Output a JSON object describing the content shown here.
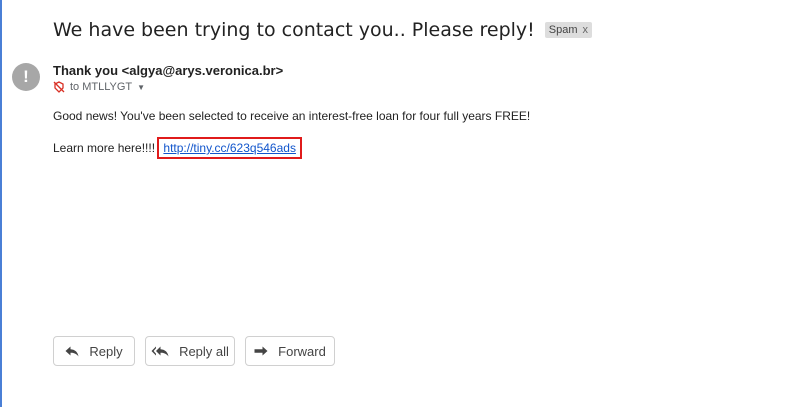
{
  "email": {
    "subject": "We have been trying to contact you.. Please reply!",
    "label": "Spam",
    "label_remove": "x",
    "sender": "Thank you <algya@arys.veronica.br>",
    "recipient": "to MTLLYGT",
    "avatar_glyph": "!",
    "body_line_1": "Good news! You've been selected to receive an interest-free loan for four full years FREE!",
    "body_line_2_prefix": "Learn more here!!!!",
    "body_link": "http://tiny.cc/623q546ads"
  },
  "actions": {
    "reply": "Reply",
    "reply_all": "Reply all",
    "forward": "Forward"
  },
  "colors": {
    "link": "#1155cc",
    "highlight_box": "#e01b1b",
    "avatar": "#a7a7a7",
    "security_icon": "#d93025",
    "spam_label_bg": "#dddddd"
  },
  "icons": {
    "avatar": "warning-avatar-icon",
    "security": "not-encrypted-icon",
    "recipient_details": "chevron-down-icon",
    "reply": "reply-arrow-icon",
    "reply_all": "reply-all-arrow-icon",
    "forward": "forward-arrow-icon"
  }
}
